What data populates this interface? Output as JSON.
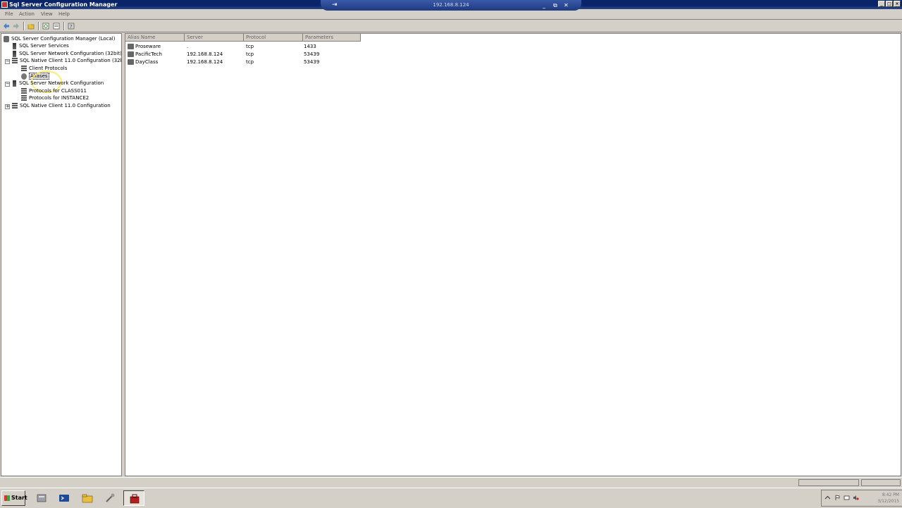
{
  "window": {
    "title": "Sql Server Configuration Manager"
  },
  "remote_bar": {
    "ip": "192.168.8.124",
    "pin_glyph": "⇥",
    "minimize_glyph": "_",
    "restore_glyph": "⧉",
    "close_glyph": "✕"
  },
  "window_buttons": {
    "minimize": "_",
    "maximize": "□",
    "close": "×"
  },
  "menu": {
    "file": "File",
    "action": "Action",
    "view": "View",
    "help": "Help"
  },
  "tree": {
    "root": "SQL Server Configuration Manager (Local)",
    "items": [
      {
        "label": "SQL Server Services",
        "expander": ""
      },
      {
        "label": "SQL Server Network Configuration (32bit)",
        "expander": ""
      },
      {
        "label": "SQL Native Client 11.0 Configuration (32bit)",
        "expander": "−"
      },
      {
        "label": "Client Protocols",
        "expander": ""
      },
      {
        "label": "Aliases",
        "expander": ""
      },
      {
        "label": "SQL Server Network Configuration",
        "expander": "−"
      },
      {
        "label": "Protocols for CLASS011",
        "expander": ""
      },
      {
        "label": "Protocols for INSTANCE2",
        "expander": ""
      },
      {
        "label": "SQL Native Client 11.0 Configuration",
        "expander": "+"
      }
    ]
  },
  "list": {
    "columns": [
      "Alias Name",
      "Server",
      "Protocol",
      "Parameters"
    ],
    "rows": [
      {
        "alias": "Proseware",
        "server": ".",
        "protocol": "tcp",
        "parameters": "1433"
      },
      {
        "alias": "PacificTech",
        "server": "192.168.8.124",
        "protocol": "tcp",
        "parameters": "53439"
      },
      {
        "alias": "DayClass",
        "server": "192.168.8.124",
        "protocol": "tcp",
        "parameters": "53439"
      }
    ]
  },
  "taskbar": {
    "start_label": "Start",
    "clock_time": "8:42 PM",
    "clock_date": "3/12/2015"
  },
  "colors": {
    "titlebar": "#0a246a",
    "rdbar": "#2a4a98",
    "chrome": "#d4d0c8"
  }
}
